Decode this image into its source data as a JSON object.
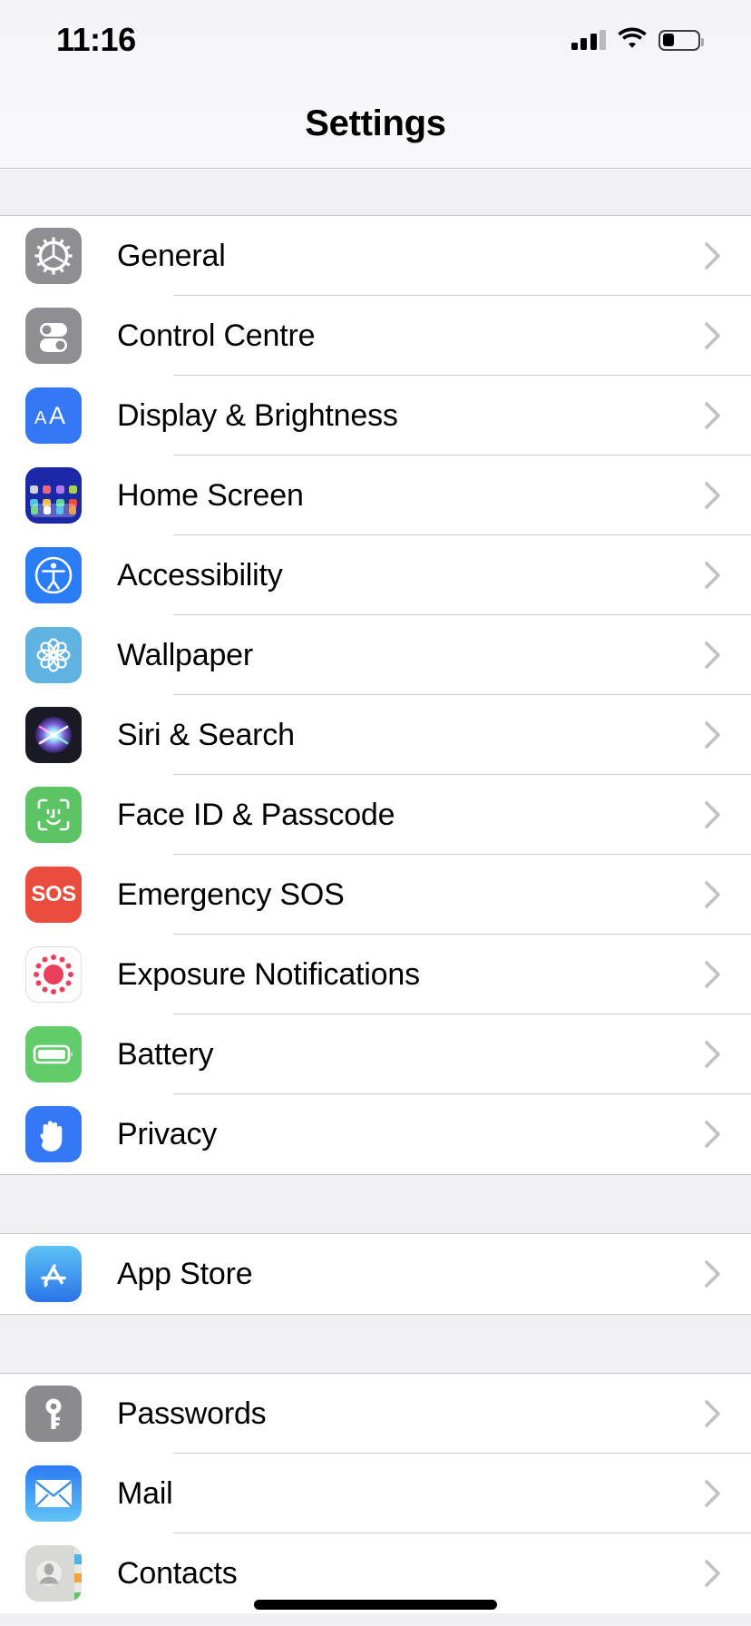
{
  "status_bar": {
    "time": "11:16",
    "signal_icon": "cellular-signal-icon",
    "wifi_icon": "wifi-icon",
    "battery_icon": "battery-icon",
    "battery_level_percent": 35
  },
  "nav": {
    "title": "Settings"
  },
  "colors": {
    "accent_blue": "#3478f6",
    "group_background": "#f0f0f4",
    "row_background": "#ffffff",
    "separator": "#c9c9cc",
    "chevron": "#c0c0c5",
    "label_text": "#000000"
  },
  "sections": [
    {
      "name": "system-settings-group",
      "items": [
        {
          "label": "General",
          "icon": "gear-icon",
          "chevron": "chevron-right-icon"
        },
        {
          "label": "Control Centre",
          "icon": "control-centre-toggles-icon",
          "chevron": "chevron-right-icon"
        },
        {
          "label": "Display & Brightness",
          "icon": "display-brightness-aa-icon",
          "chevron": "chevron-right-icon"
        },
        {
          "label": "Home Screen",
          "icon": "home-screen-grid-icon",
          "chevron": "chevron-right-icon"
        },
        {
          "label": "Accessibility",
          "icon": "accessibility-person-icon",
          "chevron": "chevron-right-icon"
        },
        {
          "label": "Wallpaper",
          "icon": "wallpaper-flower-icon",
          "chevron": "chevron-right-icon"
        },
        {
          "label": "Siri & Search",
          "icon": "siri-orb-icon",
          "chevron": "chevron-right-icon"
        },
        {
          "label": "Face ID & Passcode",
          "icon": "face-id-icon",
          "chevron": "chevron-right-icon"
        },
        {
          "label": "Emergency SOS",
          "icon": "emergency-sos-icon",
          "chevron": "chevron-right-icon"
        },
        {
          "label": "Exposure Notifications",
          "icon": "exposure-notifications-icon",
          "chevron": "chevron-right-icon"
        },
        {
          "label": "Battery",
          "icon": "battery-green-icon",
          "chevron": "chevron-right-icon"
        },
        {
          "label": "Privacy",
          "icon": "privacy-hand-icon",
          "chevron": "chevron-right-icon"
        }
      ]
    },
    {
      "name": "store-group",
      "items": [
        {
          "label": "App Store",
          "icon": "app-store-icon",
          "chevron": "chevron-right-icon"
        }
      ]
    },
    {
      "name": "apps-group",
      "items": [
        {
          "label": "Passwords",
          "icon": "passwords-key-icon",
          "chevron": "chevron-right-icon"
        },
        {
          "label": "Mail",
          "icon": "mail-envelope-icon",
          "chevron": "chevron-right-icon"
        },
        {
          "label": "Contacts",
          "icon": "contacts-person-icon",
          "chevron": "chevron-right-icon"
        }
      ]
    }
  ],
  "home_indicator": "home-indicator-bar"
}
